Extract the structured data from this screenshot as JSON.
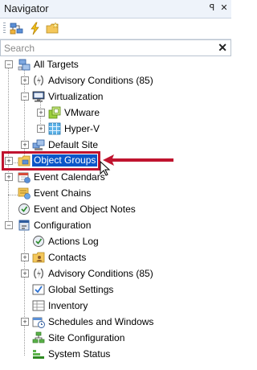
{
  "panel": {
    "title": "Navigator",
    "pin_glyph": "ꟼ",
    "close_glyph": "✕"
  },
  "toolbar": {
    "tools": [
      "network-topology-icon",
      "lightning-icon",
      "folder-star-icon"
    ]
  },
  "search": {
    "placeholder": "Search",
    "value": "",
    "clear_glyph": "✕"
  },
  "tree": [
    {
      "label": "All Targets",
      "icon": "all-targets-icon",
      "expander": "−"
    },
    {
      "label": "Advisory Conditions (85)",
      "icon": "advisory-conditions-icon",
      "expander": "+"
    },
    {
      "label": "Virtualization",
      "icon": "monitor-icon",
      "expander": "−"
    },
    {
      "label": "VMware",
      "icon": "vmware-icon",
      "expander": "+"
    },
    {
      "label": "Hyper-V",
      "icon": "hyperv-icon",
      "expander": "+"
    },
    {
      "label": "Default Site",
      "icon": "site-icon",
      "expander": "+"
    },
    {
      "label": "Object Groups",
      "icon": "folder-icon",
      "expander": "+",
      "selected": true
    },
    {
      "label": "Event Calendars",
      "icon": "calendar-icon",
      "expander": "+"
    },
    {
      "label": "Event Chains",
      "icon": "event-chain-icon",
      "expander": ""
    },
    {
      "label": "Event and Object Notes",
      "icon": "notes-icon",
      "expander": ""
    },
    {
      "label": "Configuration",
      "icon": "configuration-icon",
      "expander": "−"
    },
    {
      "label": "Actions Log",
      "icon": "actions-log-icon",
      "expander": ""
    },
    {
      "label": "Contacts",
      "icon": "contacts-icon",
      "expander": "+"
    },
    {
      "label": "Advisory Conditions (85)",
      "icon": "advisory-conditions-icon",
      "expander": "+"
    },
    {
      "label": "Global Settings",
      "icon": "global-settings-icon",
      "expander": ""
    },
    {
      "label": "Inventory",
      "icon": "inventory-icon",
      "expander": ""
    },
    {
      "label": "Schedules and Windows",
      "icon": "schedule-icon",
      "expander": "+"
    },
    {
      "label": "Site Configuration",
      "icon": "site-configuration-icon",
      "expander": ""
    },
    {
      "label": "System Status",
      "icon": "system-status-icon",
      "expander": ""
    }
  ],
  "annotation": {
    "highlight_color": "#c0142f"
  }
}
